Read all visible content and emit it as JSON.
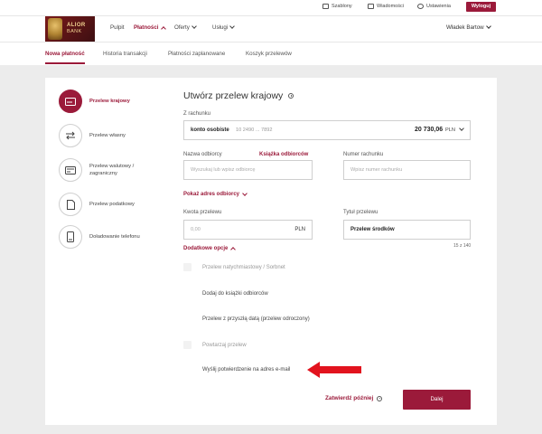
{
  "topbar": {
    "items": [
      {
        "label": "Szablony",
        "icon": "template-icon"
      },
      {
        "label": "Wiadomości",
        "icon": "mail-icon"
      },
      {
        "label": "Ustawienia",
        "icon": "gear-icon"
      }
    ],
    "logout_label": "Wyloguj"
  },
  "brand": {
    "line1": "ALIOR",
    "line2": "BANK",
    "color": "#9b1a3a"
  },
  "nav": [
    {
      "label": "Pulpit"
    },
    {
      "label": "Płatności"
    },
    {
      "label": "Oferty"
    },
    {
      "label": "Usługi"
    }
  ],
  "user": {
    "name": "Władek Bartow"
  },
  "subtabs": [
    {
      "label": "Nowa płatność"
    },
    {
      "label": "Historia transakcji"
    },
    {
      "label": "Płatności zaplanowane"
    },
    {
      "label": "Koszyk przelewów"
    }
  ],
  "sidebar": [
    {
      "label": "Przelew krajowy",
      "icon": "transfer-card-icon"
    },
    {
      "label": "Przelew własny",
      "icon": "exchange-arrows-icon"
    },
    {
      "label": "Przelew walutowy / zagraniczny",
      "icon": "currency-transfer-icon"
    },
    {
      "label": "Przelew podatkowy",
      "icon": "tax-document-icon"
    },
    {
      "label": "Doładowanie telefonu",
      "icon": "phone-icon"
    }
  ],
  "form": {
    "title": "Utwórz przelew krajowy",
    "from_label": "Z rachunku",
    "from_account_name": "konto osobiste",
    "from_account_number": "10 2490 ... 7892",
    "from_balance": "20 730,06",
    "from_currency": "PLN",
    "recipient_label": "Nazwa odbiorcy",
    "address_book_link": "Książka odbiorców",
    "recipient_placeholder": "Wyszukaj lub wpisz odbiorcę",
    "account_label": "Numer rachunku",
    "account_placeholder": "Wpisz numer rachunku",
    "show_address_link": "Pokaż adres odbiorcy",
    "amount_label": "Kwota przelewu",
    "amount_placeholder": "0,00",
    "amount_currency": "PLN",
    "transfer_title_label": "Tytuł przelewu",
    "transfer_title_value": "Przelew środków",
    "title_counter": "15 z 140",
    "extra_options_link": "Dodatkowe opcje",
    "options": [
      {
        "label": "Przelew natychmiastowy / Sorbnet"
      },
      {
        "label": "Dodaj do książki odbiorców"
      },
      {
        "label": "Przelew z przyszłą datą (przelew odroczony)"
      },
      {
        "label": "Powtarzaj przelew"
      },
      {
        "label": "Wyślij potwierdzenie na adres e-mail"
      }
    ],
    "confirm_later": "Zatwierdź później",
    "next_label": "Dalej"
  }
}
